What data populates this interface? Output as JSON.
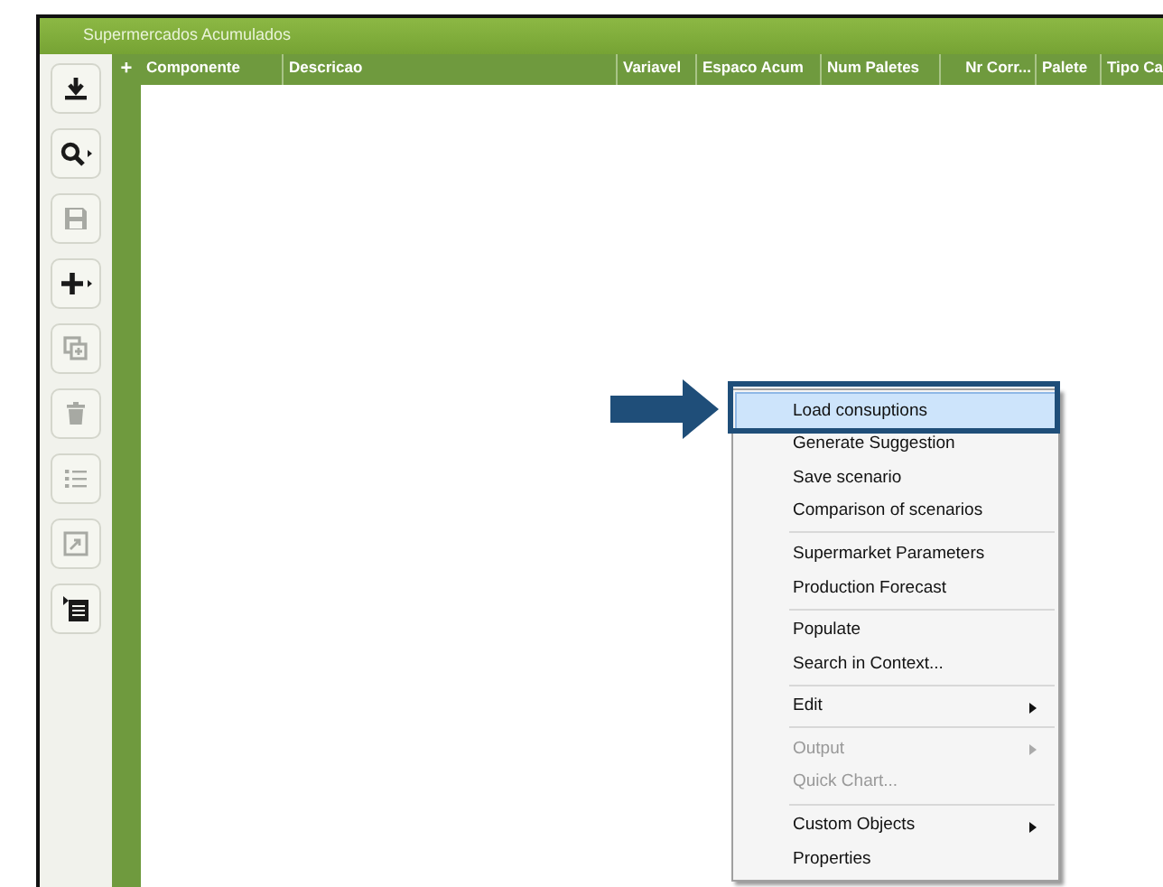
{
  "window": {
    "title": "Supermercados Acumulados"
  },
  "toolbar": [
    {
      "kind": "download",
      "disabled": false,
      "dropdown": false
    },
    {
      "kind": "search",
      "disabled": false,
      "dropdown": true
    },
    {
      "kind": "save",
      "disabled": true,
      "dropdown": false
    },
    {
      "kind": "add",
      "disabled": false,
      "dropdown": true
    },
    {
      "kind": "copy",
      "disabled": true,
      "dropdown": false
    },
    {
      "kind": "delete",
      "disabled": true,
      "dropdown": false
    },
    {
      "kind": "list",
      "disabled": true,
      "dropdown": false
    },
    {
      "kind": "expand",
      "disabled": true,
      "dropdown": false
    },
    {
      "kind": "menu",
      "disabled": false,
      "dropdown": false
    }
  ],
  "table": {
    "expander": "+",
    "columns": [
      "Componente",
      "Descricao",
      "Variavel",
      "Espaco Acum",
      "Num Paletes",
      "Nr Corr...",
      "Palete",
      "Tipo Ca"
    ]
  },
  "context_menu": [
    {
      "kind": "item",
      "label": "Load consuptions",
      "selected": true,
      "disabled": false,
      "submenu": false
    },
    {
      "kind": "item",
      "label": "Generate Suggestion",
      "selected": false,
      "disabled": false,
      "submenu": false
    },
    {
      "kind": "item",
      "label": "Save scenario",
      "selected": false,
      "disabled": false,
      "submenu": false
    },
    {
      "kind": "item",
      "label": "Comparison of scenarios",
      "selected": false,
      "disabled": false,
      "submenu": false
    },
    {
      "kind": "separator"
    },
    {
      "kind": "item",
      "label": "Supermarket Parameters",
      "selected": false,
      "disabled": false,
      "submenu": false
    },
    {
      "kind": "item",
      "label": "Production Forecast",
      "selected": false,
      "disabled": false,
      "submenu": false
    },
    {
      "kind": "separator"
    },
    {
      "kind": "item",
      "label": "Populate",
      "selected": false,
      "disabled": false,
      "submenu": false
    },
    {
      "kind": "item",
      "label": "Search in Context...",
      "selected": false,
      "disabled": false,
      "submenu": false
    },
    {
      "kind": "separator"
    },
    {
      "kind": "item",
      "label": "Edit",
      "selected": false,
      "disabled": false,
      "submenu": true
    },
    {
      "kind": "separator"
    },
    {
      "kind": "item",
      "label": "Output",
      "selected": false,
      "disabled": true,
      "submenu": true
    },
    {
      "kind": "item",
      "label": "Quick Chart...",
      "selected": false,
      "disabled": true,
      "submenu": false
    },
    {
      "kind": "separator"
    },
    {
      "kind": "item",
      "label": "Custom Objects",
      "selected": false,
      "disabled": false,
      "submenu": true
    },
    {
      "kind": "item",
      "label": "Properties",
      "selected": false,
      "disabled": false,
      "submenu": false
    }
  ]
}
